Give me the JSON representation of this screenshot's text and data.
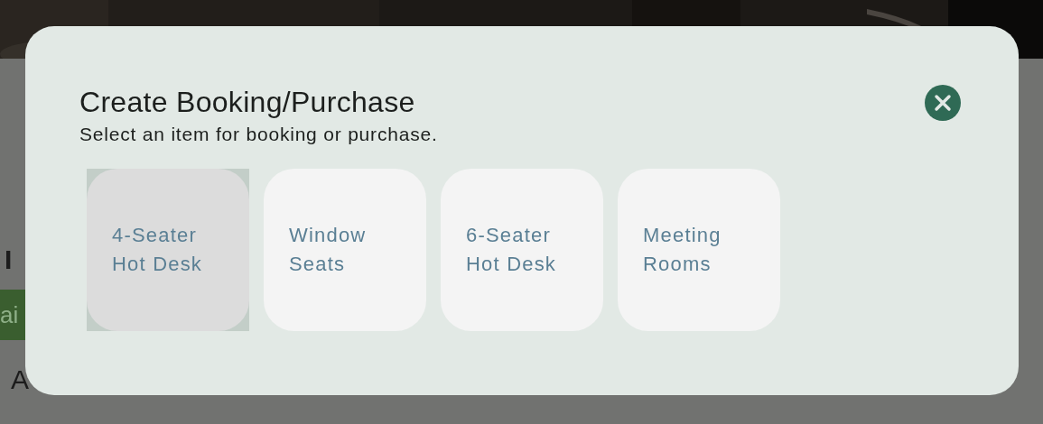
{
  "page": {
    "heading": "I",
    "badge": "ai",
    "label": "A"
  },
  "dialog": {
    "title": "Create Booking/Purchase",
    "subtitle": "Select an item for booking or purchase.",
    "items": [
      {
        "label": "4-Seater Hot Desk",
        "selected": true
      },
      {
        "label": "Window Seats",
        "selected": false
      },
      {
        "label": "6-Seater Hot Desk",
        "selected": false
      },
      {
        "label": "Meeting Rooms",
        "selected": false
      }
    ]
  }
}
